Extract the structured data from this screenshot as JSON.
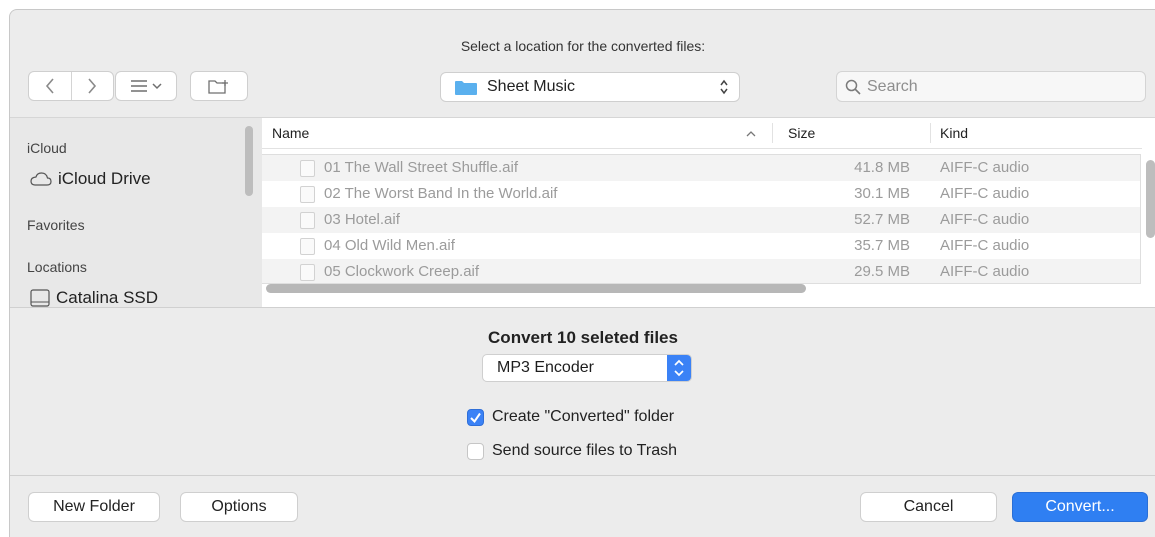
{
  "dialog": {
    "prompt": "Select a location for the converted files:"
  },
  "toolbar": {
    "back_icon": "chevron-left-icon",
    "forward_icon": "chevron-right-icon",
    "view_icon": "list-view-icon",
    "new_folder_icon": "new-folder-icon"
  },
  "location": {
    "name": "Sheet Music"
  },
  "search": {
    "placeholder": "Search"
  },
  "sidebar": {
    "icloud_header": "iCloud",
    "icloud_drive": "iCloud Drive",
    "favorites_header": "Favorites",
    "locations_header": "Locations",
    "disk": "Catalina SSD"
  },
  "filelist": {
    "columns": {
      "name": "Name",
      "size": "Size",
      "kind": "Kind"
    },
    "rows": [
      {
        "name": "01 The Wall Street Shuffle.aif",
        "size": "41.8 MB",
        "kind": "AIFF-C audio"
      },
      {
        "name": "02 The Worst Band In the World.aif",
        "size": "30.1 MB",
        "kind": "AIFF-C audio"
      },
      {
        "name": "03 Hotel.aif",
        "size": "52.7 MB",
        "kind": "AIFF-C audio"
      },
      {
        "name": "04 Old Wild Men.aif",
        "size": "35.7 MB",
        "kind": "AIFF-C audio"
      },
      {
        "name": "05 Clockwork Creep.aif",
        "size": "29.5 MB",
        "kind": "AIFF-C audio"
      }
    ]
  },
  "accessory": {
    "title": "Convert 10 seleted files",
    "encoder": "MP3 Encoder",
    "create_folder_label": "Create \"Converted\" folder",
    "create_folder_checked": true,
    "trash_label": "Send source files to Trash",
    "trash_checked": false
  },
  "buttons": {
    "new_folder": "New Folder",
    "options": "Options",
    "cancel": "Cancel",
    "convert": "Convert..."
  },
  "colors": {
    "accent": "#2f7ff2",
    "folder": "#5ab0ee"
  }
}
